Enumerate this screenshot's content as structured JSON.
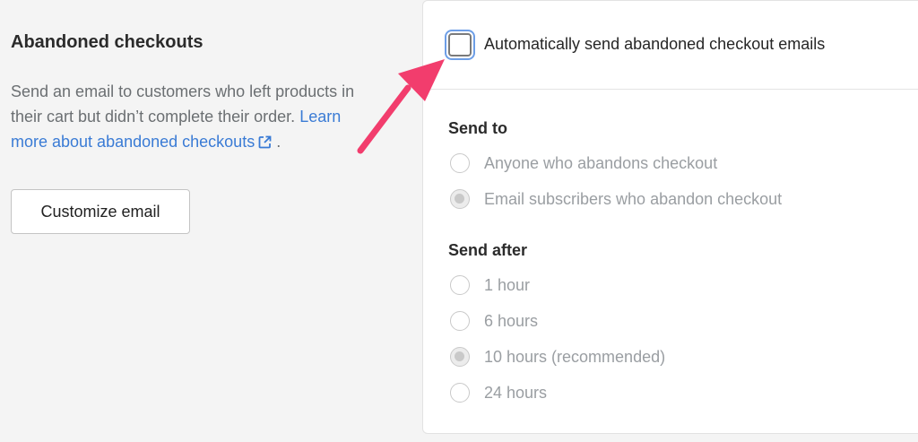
{
  "section": {
    "title": "Abandoned checkouts",
    "description": "Send an email to customers who left products in their cart but didn’t complete their order.",
    "link_text": "Learn more about abandoned checkouts",
    "link_suffix": " .",
    "button_label": "Customize email"
  },
  "settings": {
    "auto_send_label": "Automatically send abandoned checkout emails",
    "auto_send_checked": false,
    "send_to": {
      "title": "Send to",
      "options": [
        {
          "label": "Anyone who abandons checkout",
          "selected": false
        },
        {
          "label": "Email subscribers who abandon checkout",
          "selected": true
        }
      ]
    },
    "send_after": {
      "title": "Send after",
      "options": [
        {
          "label": "1 hour",
          "selected": false
        },
        {
          "label": "6 hours",
          "selected": false
        },
        {
          "label": "10 hours (recommended)",
          "selected": true
        },
        {
          "label": "24 hours",
          "selected": false
        }
      ]
    }
  },
  "colors": {
    "link": "#3a7bd5",
    "annotation_arrow": "#f23d6d",
    "focus_ring": "#6d9ee6"
  },
  "icons": {
    "external_link": "external-link-icon",
    "annotation": "pink-arrow-annotation"
  }
}
